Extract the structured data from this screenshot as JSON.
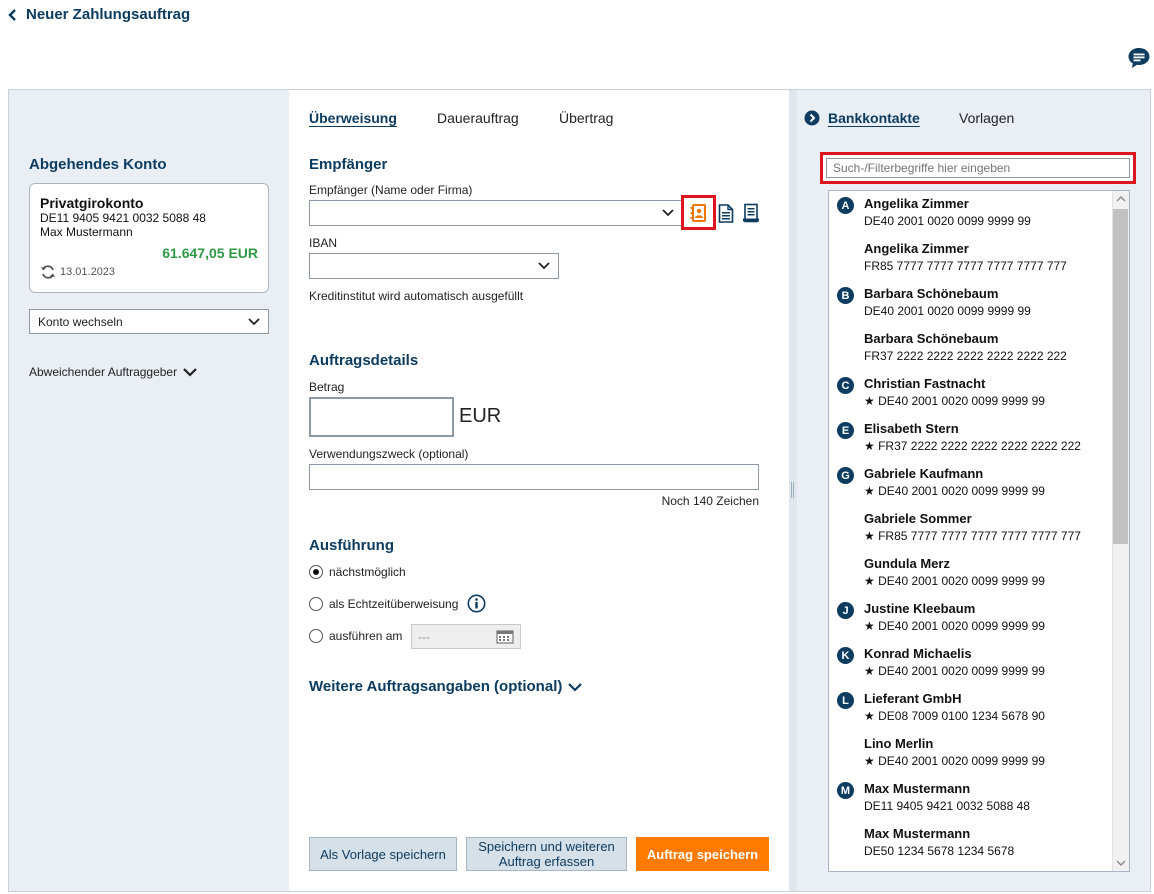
{
  "header": {
    "title": "Neuer Zahlungsauftrag",
    "accent_color": "#0c3c60"
  },
  "left": {
    "section_title": "Abgehendes Konto",
    "account": {
      "name": "Privatgirokonto",
      "iban": "DE11 9405 9421 0032 5088 48",
      "owner": "Max Mustermann",
      "balance": "61.647,05 EUR",
      "date": "13.01.2023",
      "balance_color": "#2f9a45"
    },
    "switch_account": "Konto wechseln",
    "different_payer": "Abweichender Auftraggeber"
  },
  "tabs": [
    {
      "label": "Überweisung",
      "active": true
    },
    {
      "label": "Dauerauftrag",
      "active": false
    },
    {
      "label": "Übertrag",
      "active": false
    }
  ],
  "form": {
    "recipient_title": "Empfänger",
    "recipient_label": "Empfänger (Name oder Firma)",
    "recipient_value": "",
    "iban_label": "IBAN",
    "iban_value": "",
    "bank_note": "Kreditinstitut wird automatisch ausgefüllt",
    "details_title": "Auftragsdetails",
    "amount_label": "Betrag",
    "amount_value": "",
    "currency": "EUR",
    "purpose_label": "Verwendungszweck (optional)",
    "purpose_value": "",
    "chars_left": "Noch 140 Zeichen",
    "execution_title": "Ausführung",
    "execution_options": [
      {
        "label": "nächstmöglich",
        "selected": true
      },
      {
        "label": "als Echtzeitüberweisung",
        "selected": false
      },
      {
        "label": "ausführen am",
        "selected": false
      }
    ],
    "date_placeholder": "---",
    "more_title": "Weitere Auftragsangaben (optional)"
  },
  "buttons": {
    "save_template": "Als Vorlage speichern",
    "save_and_more": "Speichern und weiteren Auftrag erfassen",
    "save_order": "Auftrag speichern",
    "primary_color": "#ff7a00"
  },
  "right": {
    "tabs": [
      {
        "label": "Bankkontakte",
        "active": true
      },
      {
        "label": "Vorlagen",
        "active": false
      }
    ],
    "search_placeholder": "Such-/Filterbegriffe hier eingeben",
    "contacts": [
      {
        "letter": "A",
        "name": "Angelika Zimmer",
        "iban": "DE40 2001 0020 0099 9999 99",
        "star": false
      },
      {
        "letter": "",
        "name": "Angelika Zimmer",
        "iban": "FR85 7777 7777 7777 7777 7777 777",
        "star": false
      },
      {
        "letter": "B",
        "name": "Barbara Schönebaum",
        "iban": "DE40 2001 0020 0099 9999 99",
        "star": false
      },
      {
        "letter": "",
        "name": "Barbara Schönebaum",
        "iban": "FR37 2222 2222 2222 2222 2222 222",
        "star": false
      },
      {
        "letter": "C",
        "name": "Christian Fastnacht",
        "iban": "DE40 2001 0020 0099 9999 99",
        "star": true
      },
      {
        "letter": "E",
        "name": "Elisabeth Stern",
        "iban": "FR37 2222 2222 2222 2222 2222 222",
        "star": true
      },
      {
        "letter": "G",
        "name": "Gabriele Kaufmann",
        "iban": "DE40 2001 0020 0099 9999 99",
        "star": true
      },
      {
        "letter": "",
        "name": "Gabriele Sommer",
        "iban": "FR85 7777 7777 7777 7777 7777 777",
        "star": true
      },
      {
        "letter": "",
        "name": "Gundula Merz",
        "iban": "DE40 2001 0020 0099 9999 99",
        "star": true
      },
      {
        "letter": "J",
        "name": "Justine Kleebaum",
        "iban": "DE40 2001 0020 0099 9999 99",
        "star": true
      },
      {
        "letter": "K",
        "name": "Konrad Michaelis",
        "iban": "DE40 2001 0020 0099 9999 99",
        "star": true
      },
      {
        "letter": "L",
        "name": "Lieferant GmbH",
        "iban": "DE08 7009 0100 1234 5678 90",
        "star": true
      },
      {
        "letter": "",
        "name": "Lino Merlin",
        "iban": "DE40 2001 0020 0099 9999 99",
        "star": true
      },
      {
        "letter": "M",
        "name": "Max Mustermann",
        "iban": "DE11 9405 9421 0032 5088 48",
        "star": false
      },
      {
        "letter": "",
        "name": "Max Mustermann",
        "iban": "DE50 1234 5678 1234 5678",
        "star": false
      }
    ]
  }
}
